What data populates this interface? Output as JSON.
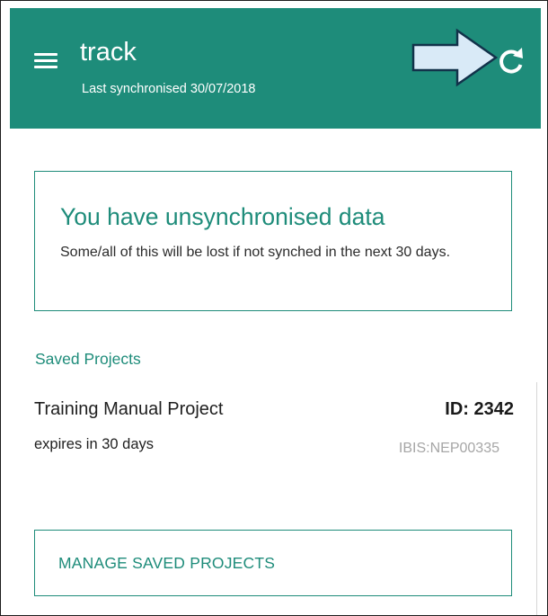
{
  "app": {
    "title": "track",
    "last_sync": "Last synchronised 30/07/2018",
    "menu_icon": "hamburger-menu-icon",
    "refresh_icon": "refresh-icon",
    "annotation_icon": "right-arrow-annotation"
  },
  "warning": {
    "title": "You have unsynchronised data",
    "message": "Some/all of this will be lost if not synched in the next 30 days."
  },
  "saved_projects": {
    "header": "Saved Projects",
    "items": [
      {
        "name": "Training Manual Project",
        "id_label": "ID: 2342",
        "expiry": "expires in 30 days",
        "code": "IBIS:NEP00335"
      }
    ],
    "manage_button_label": "MANAGE SAVED PROJECTS"
  },
  "colors": {
    "brand": "#1e8c7a",
    "text": "#1f1f1f",
    "muted": "#a6a6a6",
    "annotation_fill": "#d9eaf7"
  }
}
